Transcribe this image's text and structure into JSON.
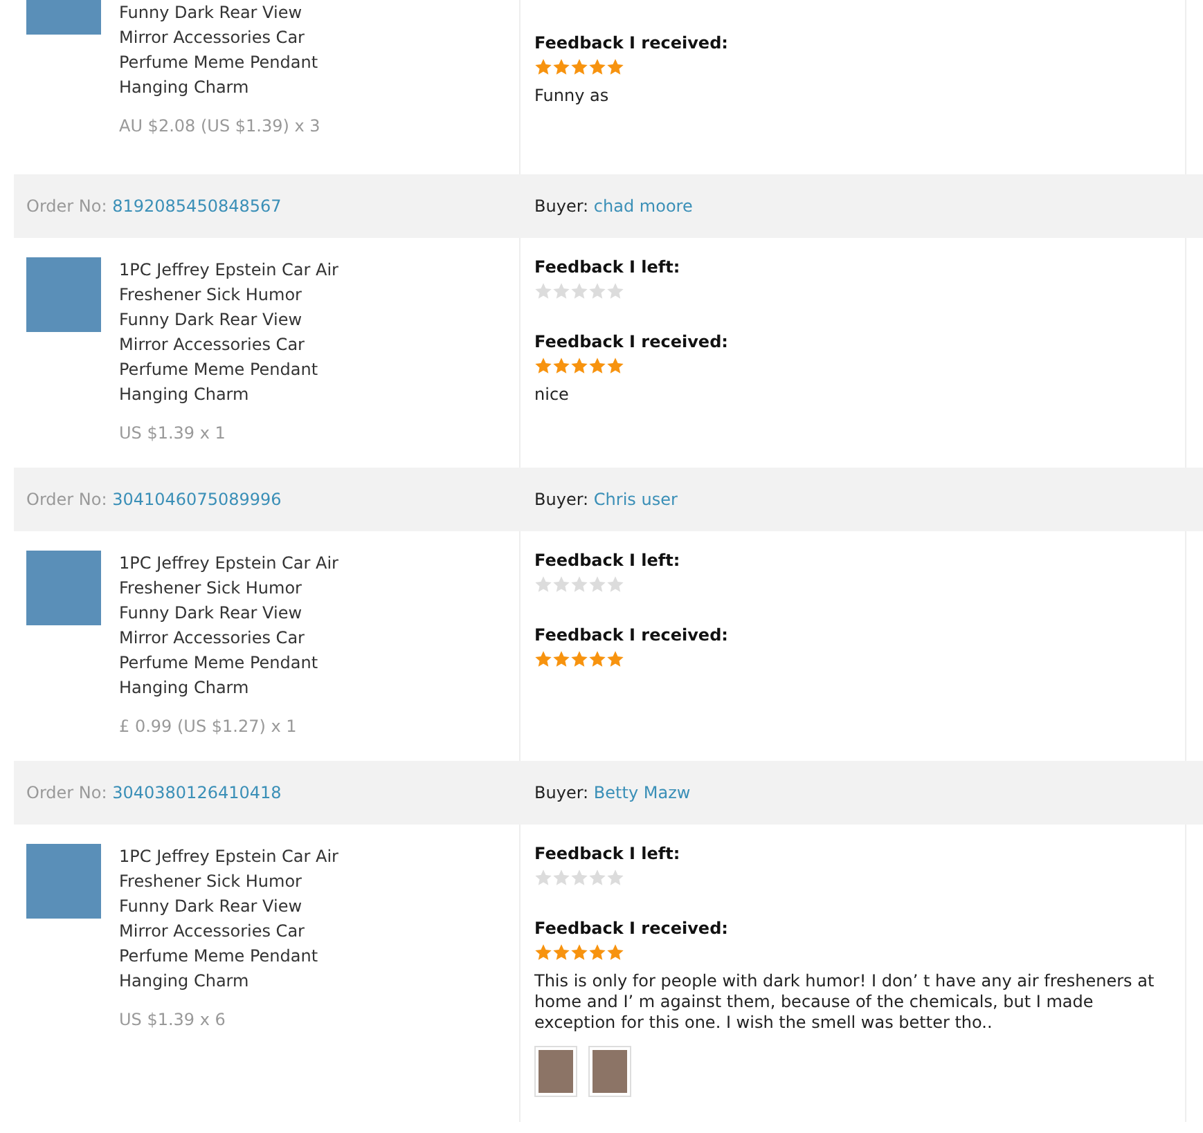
{
  "orders": [
    {
      "product": {
        "lines": [
          "Funny Dark Rear View",
          "Mirror Accessories Car",
          "Perfume Meme Pendant",
          "Hanging Charm"
        ],
        "price": "AU $2.08 (US $1.39) x 3"
      },
      "feedback_received": {
        "label": "Feedback I received:",
        "stars": 5,
        "comment": "Funny as"
      }
    },
    {
      "order_label": "Order No:",
      "order_no": "8192085450848567",
      "buyer_label": "Buyer:",
      "buyer": "chad moore",
      "product": {
        "lines": [
          "1PC Jeffrey Epstein Car Air",
          "Freshener Sick Humor",
          "Funny Dark Rear View",
          "Mirror Accessories Car",
          "Perfume Meme Pendant",
          "Hanging Charm"
        ],
        "price": "US $1.39 x 1"
      },
      "feedback_left": {
        "label": "Feedback I left:",
        "stars": 0
      },
      "feedback_received": {
        "label": "Feedback I received:",
        "stars": 5,
        "comment": "nice"
      }
    },
    {
      "order_label": "Order No:",
      "order_no": "3041046075089996",
      "buyer_label": "Buyer:",
      "buyer": "Chris user",
      "product": {
        "lines": [
          "1PC Jeffrey Epstein Car Air",
          "Freshener Sick Humor",
          "Funny Dark Rear View",
          "Mirror Accessories Car",
          "Perfume Meme Pendant",
          "Hanging Charm"
        ],
        "price": "£ 0.99 (US $1.27) x 1"
      },
      "feedback_left": {
        "label": "Feedback I left:",
        "stars": 0
      },
      "feedback_received": {
        "label": "Feedback I received:",
        "stars": 5
      }
    },
    {
      "order_label": "Order No:",
      "order_no": "3040380126410418",
      "buyer_label": "Buyer:",
      "buyer": "Betty Mazw",
      "product": {
        "lines": [
          "1PC Jeffrey Epstein Car Air",
          "Freshener Sick Humor",
          "Funny Dark Rear View",
          "Mirror Accessories Car",
          "Perfume Meme Pendant",
          "Hanging Charm"
        ],
        "price": "US $1.39 x 6"
      },
      "feedback_left": {
        "label": "Feedback I left:",
        "stars": 0
      },
      "feedback_received": {
        "label": "Feedback I received:",
        "stars": 5,
        "comment": "This is only for people with dark humor! I don’ t have any air fresheners at home and I’ m against them, because of the chemicals, but I made exception for this one. I wish the smell was better tho..",
        "photos": [
          {
            "kind": "photo"
          },
          {
            "kind": "photo"
          }
        ]
      }
    }
  ]
}
